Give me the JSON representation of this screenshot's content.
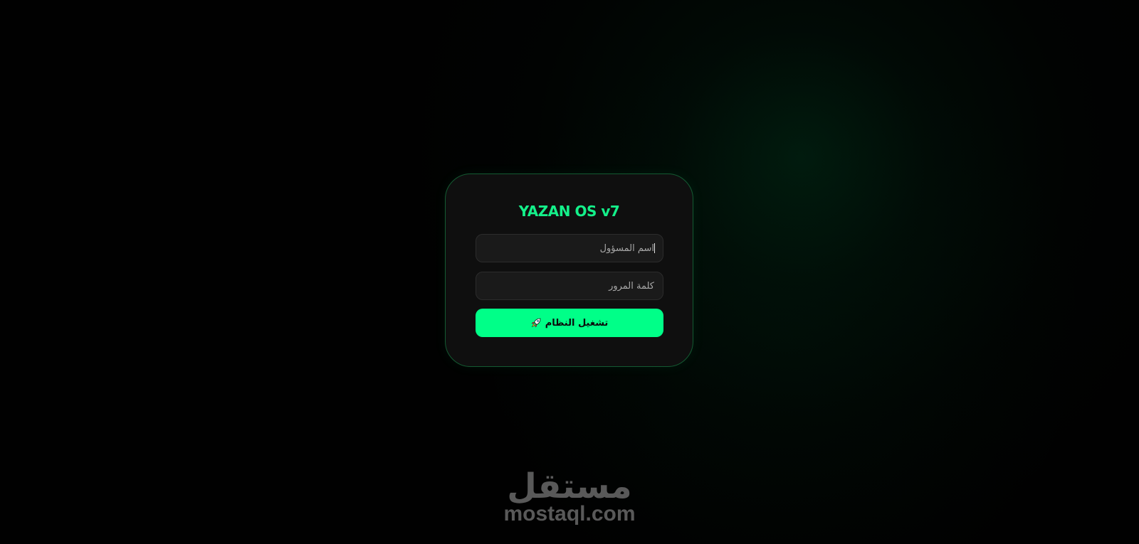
{
  "app": {
    "title": "YAZAN OS v7"
  },
  "login": {
    "username": {
      "value": "",
      "placeholder": "اسم المسؤول"
    },
    "password": {
      "value": "",
      "placeholder": "كلمة المرور"
    },
    "submit": {
      "label": "تشغيل النظام",
      "icon": "rocket-icon"
    }
  },
  "watermark": {
    "arabic": "مستقل",
    "latin": "mostaql.com"
  },
  "colors": {
    "accent": "#00ff88",
    "title": "#14f08a",
    "card_bg": "#0f0f0f",
    "field_bg": "#1a1a1a",
    "card_border": "#145a32",
    "watermark": "#595959"
  }
}
